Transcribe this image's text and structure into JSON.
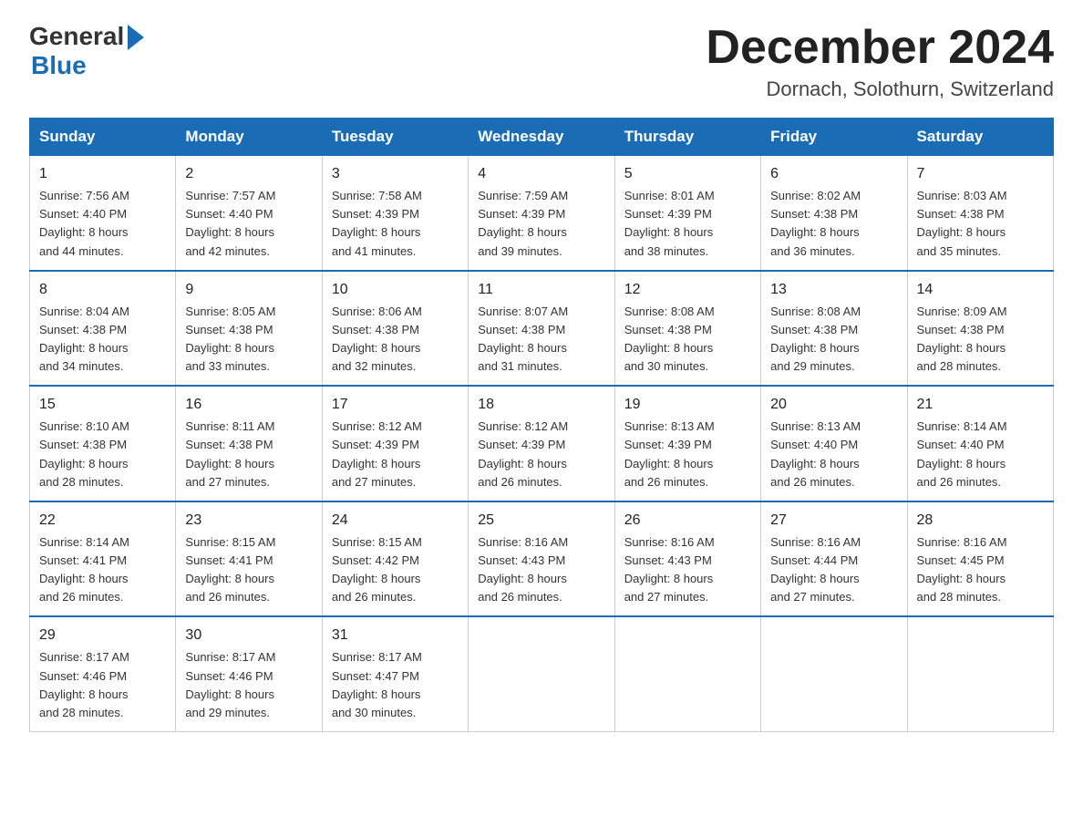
{
  "logo": {
    "general": "General",
    "blue": "Blue",
    "arrow": "▶"
  },
  "header": {
    "title": "December 2024",
    "subtitle": "Dornach, Solothurn, Switzerland"
  },
  "weekdays": [
    "Sunday",
    "Monday",
    "Tuesday",
    "Wednesday",
    "Thursday",
    "Friday",
    "Saturday"
  ],
  "weeks": [
    [
      {
        "day": "1",
        "sunrise": "7:56 AM",
        "sunset": "4:40 PM",
        "daylight": "8 hours and 44 minutes."
      },
      {
        "day": "2",
        "sunrise": "7:57 AM",
        "sunset": "4:40 PM",
        "daylight": "8 hours and 42 minutes."
      },
      {
        "day": "3",
        "sunrise": "7:58 AM",
        "sunset": "4:39 PM",
        "daylight": "8 hours and 41 minutes."
      },
      {
        "day": "4",
        "sunrise": "7:59 AM",
        "sunset": "4:39 PM",
        "daylight": "8 hours and 39 minutes."
      },
      {
        "day": "5",
        "sunrise": "8:01 AM",
        "sunset": "4:39 PM",
        "daylight": "8 hours and 38 minutes."
      },
      {
        "day": "6",
        "sunrise": "8:02 AM",
        "sunset": "4:38 PM",
        "daylight": "8 hours and 36 minutes."
      },
      {
        "day": "7",
        "sunrise": "8:03 AM",
        "sunset": "4:38 PM",
        "daylight": "8 hours and 35 minutes."
      }
    ],
    [
      {
        "day": "8",
        "sunrise": "8:04 AM",
        "sunset": "4:38 PM",
        "daylight": "8 hours and 34 minutes."
      },
      {
        "day": "9",
        "sunrise": "8:05 AM",
        "sunset": "4:38 PM",
        "daylight": "8 hours and 33 minutes."
      },
      {
        "day": "10",
        "sunrise": "8:06 AM",
        "sunset": "4:38 PM",
        "daylight": "8 hours and 32 minutes."
      },
      {
        "day": "11",
        "sunrise": "8:07 AM",
        "sunset": "4:38 PM",
        "daylight": "8 hours and 31 minutes."
      },
      {
        "day": "12",
        "sunrise": "8:08 AM",
        "sunset": "4:38 PM",
        "daylight": "8 hours and 30 minutes."
      },
      {
        "day": "13",
        "sunrise": "8:08 AM",
        "sunset": "4:38 PM",
        "daylight": "8 hours and 29 minutes."
      },
      {
        "day": "14",
        "sunrise": "8:09 AM",
        "sunset": "4:38 PM",
        "daylight": "8 hours and 28 minutes."
      }
    ],
    [
      {
        "day": "15",
        "sunrise": "8:10 AM",
        "sunset": "4:38 PM",
        "daylight": "8 hours and 28 minutes."
      },
      {
        "day": "16",
        "sunrise": "8:11 AM",
        "sunset": "4:38 PM",
        "daylight": "8 hours and 27 minutes."
      },
      {
        "day": "17",
        "sunrise": "8:12 AM",
        "sunset": "4:39 PM",
        "daylight": "8 hours and 27 minutes."
      },
      {
        "day": "18",
        "sunrise": "8:12 AM",
        "sunset": "4:39 PM",
        "daylight": "8 hours and 26 minutes."
      },
      {
        "day": "19",
        "sunrise": "8:13 AM",
        "sunset": "4:39 PM",
        "daylight": "8 hours and 26 minutes."
      },
      {
        "day": "20",
        "sunrise": "8:13 AM",
        "sunset": "4:40 PM",
        "daylight": "8 hours and 26 minutes."
      },
      {
        "day": "21",
        "sunrise": "8:14 AM",
        "sunset": "4:40 PM",
        "daylight": "8 hours and 26 minutes."
      }
    ],
    [
      {
        "day": "22",
        "sunrise": "8:14 AM",
        "sunset": "4:41 PM",
        "daylight": "8 hours and 26 minutes."
      },
      {
        "day": "23",
        "sunrise": "8:15 AM",
        "sunset": "4:41 PM",
        "daylight": "8 hours and 26 minutes."
      },
      {
        "day": "24",
        "sunrise": "8:15 AM",
        "sunset": "4:42 PM",
        "daylight": "8 hours and 26 minutes."
      },
      {
        "day": "25",
        "sunrise": "8:16 AM",
        "sunset": "4:43 PM",
        "daylight": "8 hours and 26 minutes."
      },
      {
        "day": "26",
        "sunrise": "8:16 AM",
        "sunset": "4:43 PM",
        "daylight": "8 hours and 27 minutes."
      },
      {
        "day": "27",
        "sunrise": "8:16 AM",
        "sunset": "4:44 PM",
        "daylight": "8 hours and 27 minutes."
      },
      {
        "day": "28",
        "sunrise": "8:16 AM",
        "sunset": "4:45 PM",
        "daylight": "8 hours and 28 minutes."
      }
    ],
    [
      {
        "day": "29",
        "sunrise": "8:17 AM",
        "sunset": "4:46 PM",
        "daylight": "8 hours and 28 minutes."
      },
      {
        "day": "30",
        "sunrise": "8:17 AM",
        "sunset": "4:46 PM",
        "daylight": "8 hours and 29 minutes."
      },
      {
        "day": "31",
        "sunrise": "8:17 AM",
        "sunset": "4:47 PM",
        "daylight": "8 hours and 30 minutes."
      },
      null,
      null,
      null,
      null
    ]
  ],
  "labels": {
    "sunrise": "Sunrise:",
    "sunset": "Sunset:",
    "daylight": "Daylight:"
  }
}
